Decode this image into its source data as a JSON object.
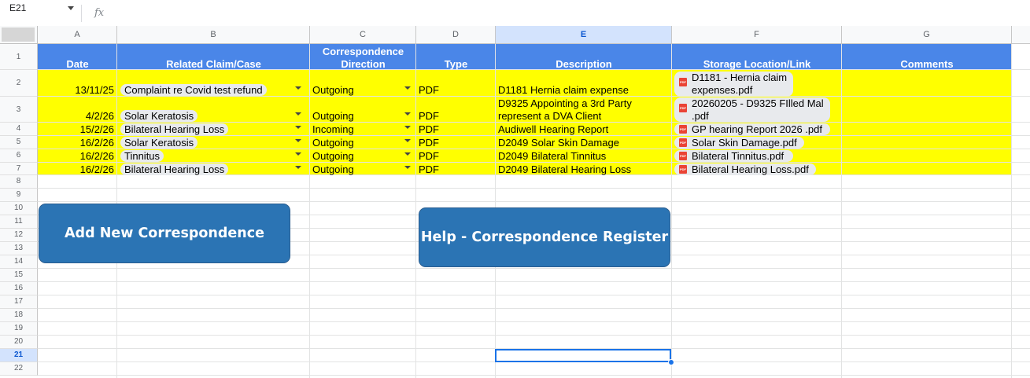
{
  "formula_bar": {
    "name_box": "E21",
    "fx": "fx",
    "formula": ""
  },
  "columns": [
    "A",
    "B",
    "C",
    "D",
    "E",
    "F",
    "G"
  ],
  "selected_column": "E",
  "rows": [
    "1",
    "2",
    "3",
    "4",
    "5",
    "6",
    "7",
    "8",
    "9",
    "10",
    "11",
    "12",
    "13",
    "14",
    "15",
    "16",
    "17",
    "18",
    "19",
    "20",
    "21",
    "22"
  ],
  "selected_row": "21",
  "header": {
    "date": "Date",
    "claim": "Related Claim/Case",
    "direction_line1": "Correspondence",
    "direction_line2": "Direction",
    "type": "Type",
    "description": "Description",
    "storage": "Storage Location/Link",
    "comments": "Comments"
  },
  "records": [
    {
      "date": "13/11/25",
      "claim": "Complaint re Covid test refund",
      "direction": "Outgoing",
      "type": "PDF",
      "description": [
        "D1181 Hernia claim expense"
      ],
      "file": [
        "D1181 - Hernia claim",
        "expenses.pdf"
      ]
    },
    {
      "date": "4/2/26",
      "claim": "Solar Keratosis",
      "direction": "Outgoing",
      "type": "PDF",
      "description": [
        "D9325 Appointing a 3rd Party",
        "represent a DVA Client"
      ],
      "file": [
        "20260205 - D9325 FIlled Mal",
        ".pdf"
      ]
    },
    {
      "date": "15/2/26",
      "claim": "Bilateral  Hearing Loss",
      "direction": "Incoming",
      "type": "PDF",
      "description": [
        "Audiwell Hearing Report"
      ],
      "file": [
        "GP hearing Report 2026 .pdf"
      ]
    },
    {
      "date": "16/2/26",
      "claim": "Solar Keratosis",
      "direction": "Outgoing",
      "type": "PDF",
      "description": [
        "D2049 Solar Skin Damage"
      ],
      "file": [
        "Solar Skin Damage.pdf"
      ]
    },
    {
      "date": "16/2/26",
      "claim": "Tinnitus",
      "direction": "Outgoing",
      "type": "PDF",
      "description": [
        "D2049 Bilateral Tinnitus"
      ],
      "file": [
        "Bilateral Tinnitus.pdf"
      ]
    },
    {
      "date": "16/2/26",
      "claim": "Bilateral  Hearing Loss",
      "direction": "Outgoing",
      "type": "PDF",
      "description": [
        "D2049 Bilateral  Hearing Loss"
      ],
      "file": [
        "Bilateral Hearing Loss.pdf"
      ]
    }
  ],
  "buttons": {
    "add": "Add New Correspondence",
    "help": "Help - Correspondence Register"
  },
  "colors": {
    "header_fill": "#4a86e8",
    "row_fill": "#ffff00",
    "button_fill": "#2b74b4",
    "selection": "#1a73e8"
  }
}
